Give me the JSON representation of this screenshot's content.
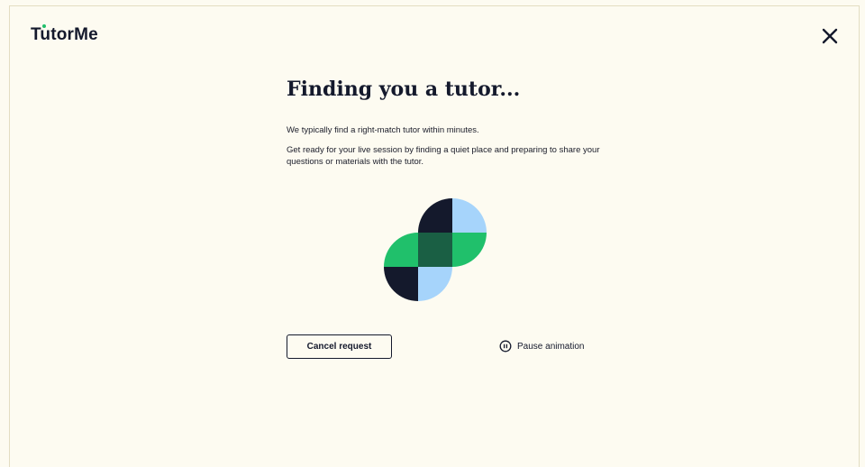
{
  "header": {
    "logo_text": "TutorMe",
    "close_icon": "close-icon"
  },
  "main": {
    "title": "Finding you a tutor...",
    "paragraph_1": "We typically find a right-match tutor within minutes.",
    "paragraph_2": "Get ready for your live session by finding a quiet place and preparing to share your questions or materials with the tutor."
  },
  "animation": {
    "icon": "matching-animation-graphic",
    "colors": {
      "navy": "#14192c",
      "light_blue": "#a6d4fb",
      "green": "#20c06b",
      "dark_green": "#1a5f44"
    }
  },
  "actions": {
    "cancel_label": "Cancel request",
    "pause_label": "Pause animation",
    "pause_icon": "pause-circle-icon"
  },
  "colors": {
    "background": "#fdfbf1",
    "text": "#14192c",
    "accent": "#20c06b"
  }
}
